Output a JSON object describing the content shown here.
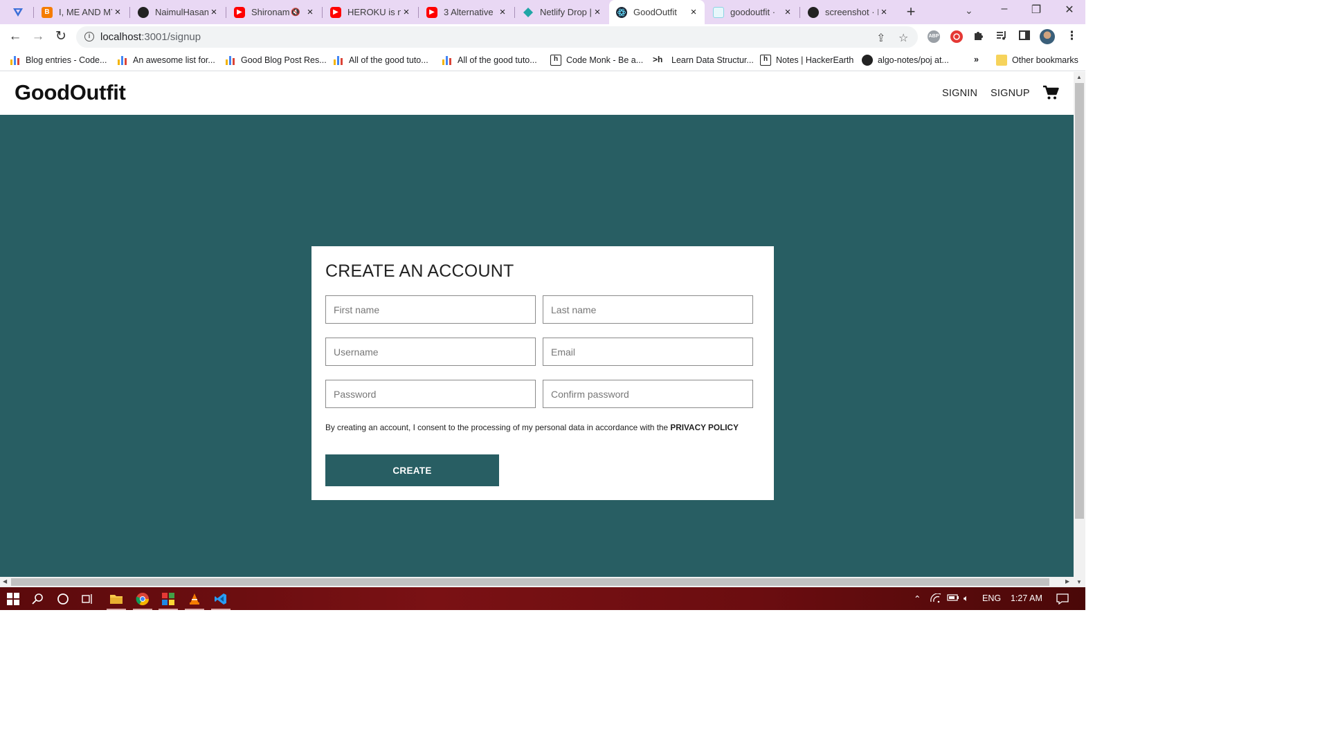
{
  "browser": {
    "tabs": [
      {
        "title": "",
        "icon": "vpn-icon",
        "color": "#3b6fd8",
        "close": ""
      },
      {
        "title": "I, ME AND MY",
        "icon": "blogger-icon",
        "color": "#f57c00",
        "close": "×"
      },
      {
        "title": "NaimulHasan",
        "icon": "github-icon",
        "color": "#222222",
        "close": "×"
      },
      {
        "title": "Shironam",
        "icon": "youtube-icon",
        "color": "#ff0000",
        "close": "×",
        "mute": "🔇"
      },
      {
        "title": "HEROKU is no",
        "icon": "youtube-icon",
        "color": "#ff0000",
        "close": "×"
      },
      {
        "title": "3 Alternative",
        "icon": "youtube-icon",
        "color": "#ff0000",
        "close": "×"
      },
      {
        "title": "Netlify Drop |",
        "icon": "netlify-icon",
        "color": "#20a6a6",
        "close": "×"
      },
      {
        "title": "GoodOutfit",
        "icon": "react-icon",
        "color": "#1f2937",
        "close": "×"
      },
      {
        "title": "goodoutfit ·",
        "icon": "page-icon",
        "color": "#8ad4e3",
        "close": "×"
      },
      {
        "title": "screenshot · I",
        "icon": "github-icon",
        "color": "#222222",
        "close": "×"
      }
    ],
    "new_tab": "+",
    "tab_search": "⌄",
    "window_controls": {
      "minimize": "–",
      "restore": "❐",
      "close": "✕"
    },
    "nav": {
      "back": "←",
      "forward": "→",
      "reload": "↻"
    },
    "url": {
      "host": "localhost",
      "path": ":3001/signup"
    },
    "extensions": [
      {
        "label": "ABP",
        "color": "#9aa0a6"
      },
      {
        "label": "",
        "color": "#e53935"
      }
    ],
    "bookmarks": [
      {
        "label": "Blog entries - Code...",
        "icon": "bar-chart-icon"
      },
      {
        "label": "An awesome list for...",
        "icon": "bar-chart-icon"
      },
      {
        "label": "Good Blog Post Res...",
        "icon": "bar-chart-icon"
      },
      {
        "label": "All of the good tuto...",
        "icon": "bar-chart-icon"
      },
      {
        "label": "All of the good tuto...",
        "icon": "bar-chart-icon"
      },
      {
        "label": "Code Monk - Be a...",
        "icon": "hackerearth-icon",
        "glyph": "h"
      },
      {
        "label": "Learn Data Structur...",
        "icon": "hackerearth-prompt-icon",
        "glyph": ">h"
      },
      {
        "label": "Notes | HackerEarth",
        "icon": "hackerearth-icon",
        "glyph": "h"
      },
      {
        "label": "algo-notes/poj at...",
        "icon": "github-icon"
      }
    ],
    "bookmarks_more": "»",
    "other_bookmarks": "Other bookmarks"
  },
  "site": {
    "logo": "GoodOutfit",
    "nav": {
      "signin": "SIGNIN",
      "signup": "SIGNUP"
    }
  },
  "signup": {
    "title": "CREATE AN ACCOUNT",
    "fields": {
      "first_name": {
        "placeholder": "First name",
        "value": ""
      },
      "last_name": {
        "placeholder": "Last name",
        "value": ""
      },
      "username": {
        "placeholder": "Username",
        "value": ""
      },
      "email": {
        "placeholder": "Email",
        "value": ""
      },
      "password": {
        "placeholder": "Password",
        "value": ""
      },
      "confirm_password": {
        "placeholder": "Confirm password",
        "value": ""
      }
    },
    "consent_text": "By creating an account, I consent to the processing of my personal data in accordance with the ",
    "consent_link": "PRIVACY POLICY",
    "submit": "CREATE"
  },
  "taskbar": {
    "tray": {
      "language": "ENG",
      "time": "1:27 AM"
    }
  },
  "colors": {
    "page_bg": "#285e63",
    "button_bg": "#285e63",
    "tabstrip_bg": "#e9d8f4",
    "taskbar_bg": "#6b0d10"
  }
}
